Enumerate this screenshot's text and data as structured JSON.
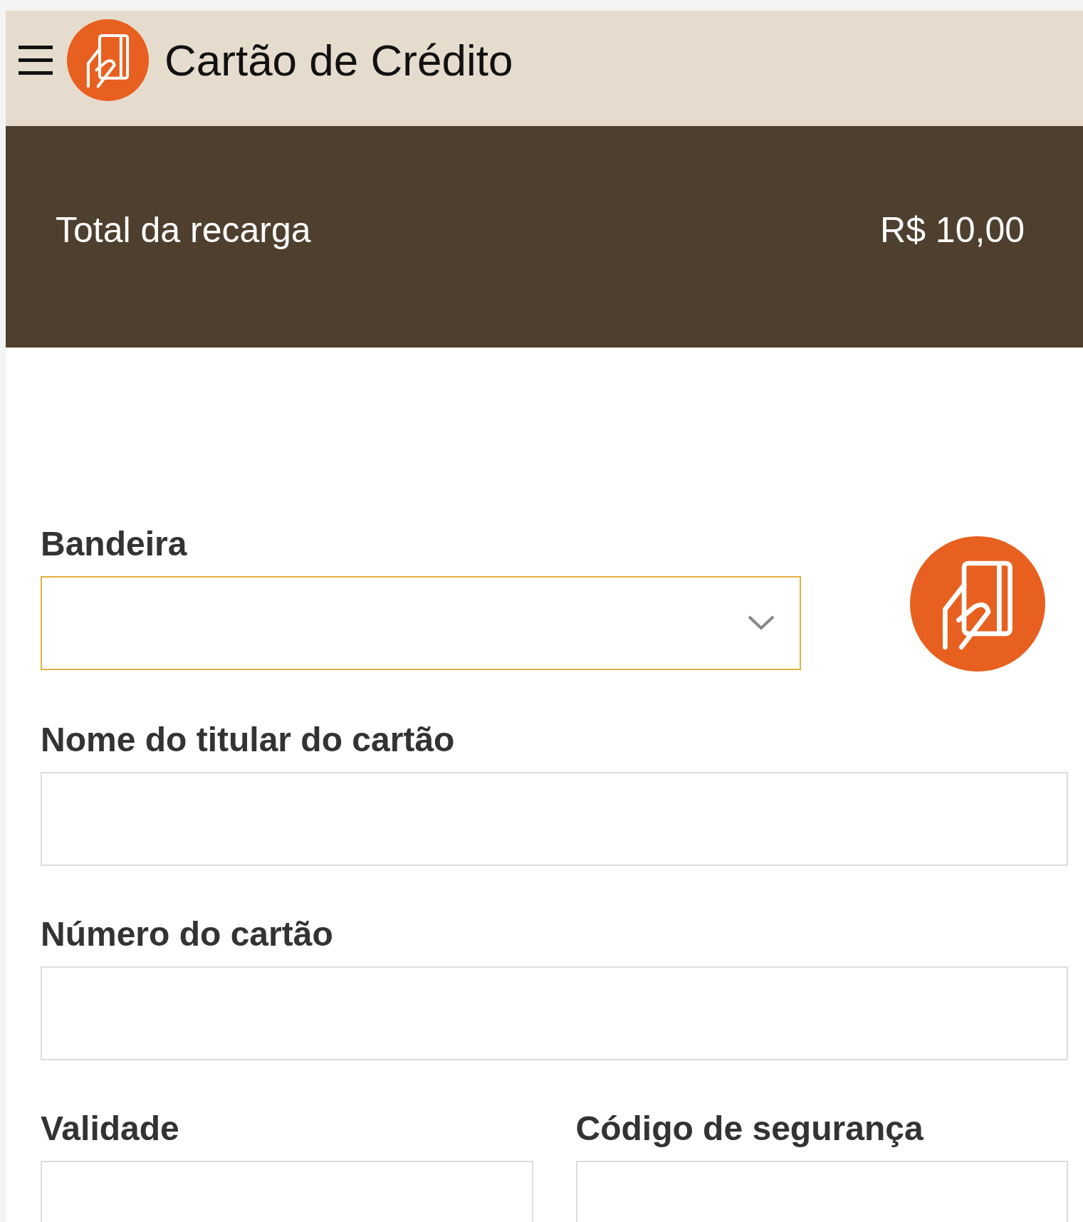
{
  "header": {
    "title": "Cartão de Crédito"
  },
  "summary": {
    "label": "Total da recarga",
    "amount": "R$ 10,00"
  },
  "form_rows": [
    {
      "fields": [
        {
          "kind": "select",
          "label": "Bandeira",
          "focused": true
        }
      ],
      "card_icon": true
    },
    {
      "fields": [
        {
          "kind": "text",
          "label": "Nome do titular do cartão",
          "focused": false
        }
      ],
      "card_icon": false
    },
    {
      "fields": [
        {
          "kind": "text",
          "label": "Número do cartão",
          "focused": false
        }
      ],
      "card_icon": false
    },
    {
      "fields": [
        {
          "kind": "text",
          "label": "Validade",
          "focused": false
        },
        {
          "kind": "text",
          "label": "Código de segurança",
          "focused": false
        }
      ],
      "card_icon": false
    }
  ]
}
